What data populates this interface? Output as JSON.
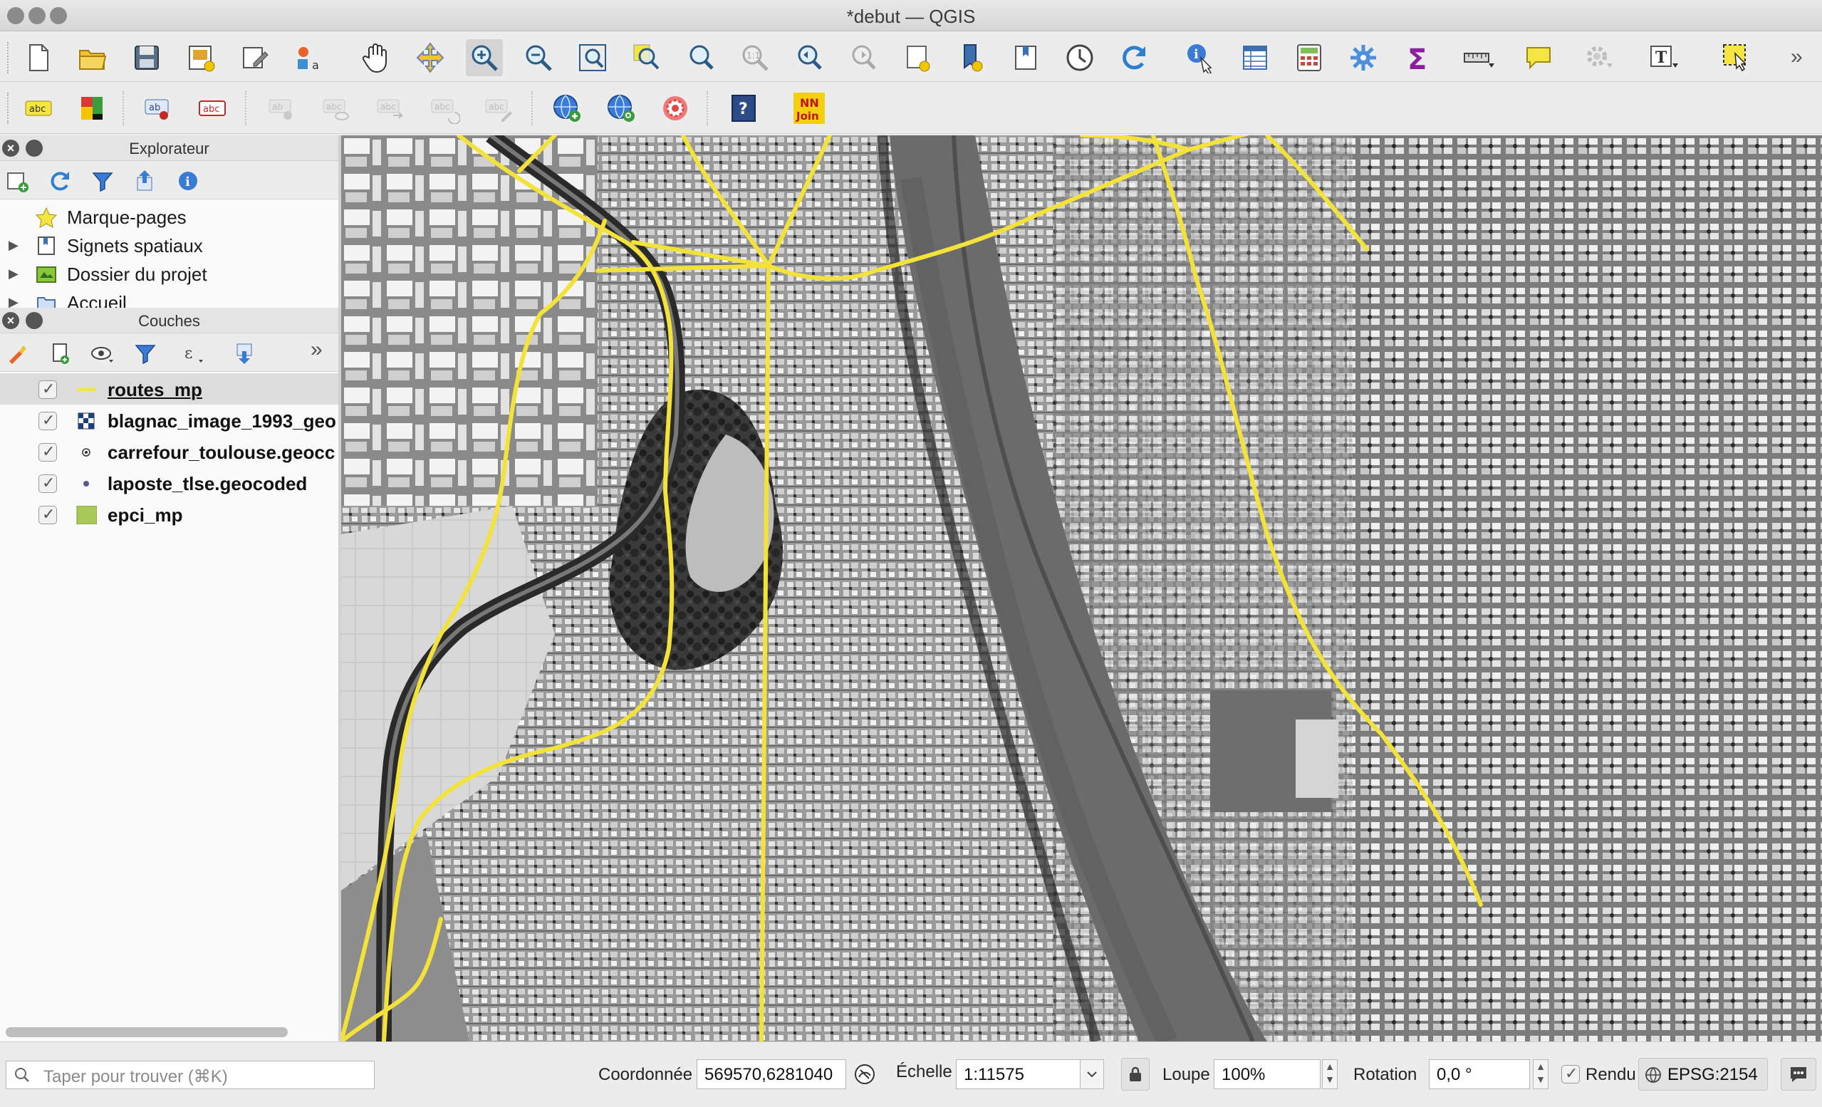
{
  "window": {
    "title": "*debut — QGIS"
  },
  "toolbar_main": {
    "items": [
      "new-project",
      "open-project",
      "save-project",
      "new-print-layout",
      "style-manager",
      "python-console",
      "pan",
      "pan-to-selection",
      "zoom-in",
      "zoom-out",
      "zoom-full",
      "zoom-to-selection",
      "zoom-to-layer",
      "zoom-native",
      "zoom-last",
      "zoom-next",
      "new-spatial-bookmark",
      "show-bookmarks",
      "temporal-controller",
      "refresh",
      "identify",
      "open-attribute-table",
      "field-calculator",
      "processing-toolbox",
      "statistical-summary",
      "measure",
      "map-tips",
      "plugins-settings",
      "text-annotation",
      "select-features",
      "more"
    ]
  },
  "toolbar_labels": {
    "items": [
      "label-layer",
      "diagram",
      "pin-labels",
      "highlight-labels",
      "show-hide-labels",
      "preview-labels",
      "move-label",
      "rotate-label",
      "change-label",
      "geocode-add",
      "geocode-search",
      "nn-target",
      "help",
      "nn-join"
    ],
    "nn_join_line1": "NN",
    "nn_join_line2": "Join"
  },
  "explorer": {
    "title": "Explorateur",
    "items": [
      {
        "label": "Marque-pages",
        "icon": "star-icon",
        "expandable": false
      },
      {
        "label": "Signets spatiaux",
        "icon": "bookmark-book-icon",
        "expandable": true
      },
      {
        "label": "Dossier du projet",
        "icon": "project-folder-icon",
        "expandable": true
      },
      {
        "label": "Accueil",
        "icon": "home-folder-icon",
        "expandable": true
      }
    ]
  },
  "layers": {
    "title": "Couches",
    "items": [
      {
        "name": "routes_mp",
        "type": "line",
        "checked": true,
        "selected": true,
        "symbol_color": "#f4e542"
      },
      {
        "name": "blagnac_image_1993_geo",
        "type": "raster",
        "checked": true,
        "selected": false
      },
      {
        "name": "carrefour_toulouse.geocc",
        "type": "point",
        "checked": true,
        "selected": false
      },
      {
        "name": "laposte_tlse.geocoded",
        "type": "point",
        "checked": true,
        "selected": false
      },
      {
        "name": "epci_mp",
        "type": "polygon",
        "checked": true,
        "selected": false,
        "symbol_color": "#a8c95a"
      }
    ]
  },
  "map": {
    "description_layer": "routes_mp",
    "road_color": "#f3e23a",
    "railway_color": "#2a2a2a"
  },
  "statusbar": {
    "locator_placeholder": "Taper pour trouver (⌘K)",
    "coordinate_label": "Coordonnée",
    "coordinate_value": "569570,6281040",
    "scale_label": "Échelle",
    "scale_value": "1:11575",
    "magnifier_label": "Loupe",
    "magnifier_value": "100%",
    "rotation_label": "Rotation",
    "rotation_value": "0,0 °",
    "render_label": "Rendu",
    "render_checked": true,
    "crs_value": "EPSG:2154"
  }
}
